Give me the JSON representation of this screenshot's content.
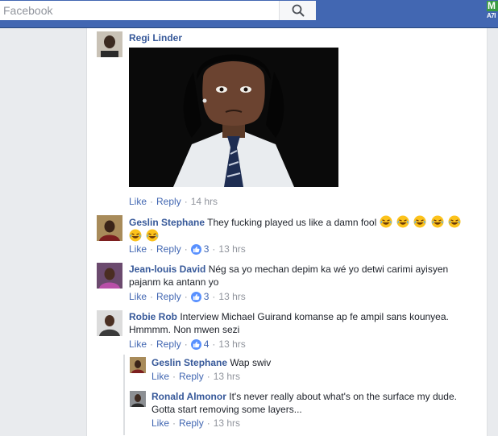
{
  "search": {
    "placeholder": "Facebook"
  },
  "brand": {
    "line1": "M",
    "line2": "A7I"
  },
  "comments": [
    {
      "author": "Regi Linder",
      "text": "",
      "has_photo": true,
      "like_label": "Like",
      "reply_label": "Reply",
      "time": "14 hrs"
    },
    {
      "author": "Geslin Stephane",
      "text": "They fucking played us like a damn fool",
      "emoji": "face-with-tears-of-joy",
      "emoji_count": 7,
      "like_label": "Like",
      "reply_label": "Reply",
      "reactions": "3",
      "time": "13 hrs"
    },
    {
      "author": "Jean-louis David",
      "text": "Nég sa yo mechan depim ka wé yo detwi carimi ayisyen pajanm ka antann yo",
      "like_label": "Like",
      "reply_label": "Reply",
      "reactions": "3",
      "time": "13 hrs"
    },
    {
      "author": "Robie Rob",
      "text": "Interview Michael Guirand komanse ap fe ampil sans kounyea. Hmmmm. Non mwen sezi",
      "like_label": "Like",
      "reply_label": "Reply",
      "reactions": "4",
      "time": "13 hrs"
    }
  ],
  "replies": [
    {
      "author": "Geslin Stephane",
      "text": "Wap swiv",
      "like_label": "Like",
      "reply_label": "Reply",
      "time": "13 hrs"
    },
    {
      "author": "Ronald Almonor",
      "text": "It's never really about what's on the surface my dude. Gotta start removing some layers...",
      "like_label": "Like",
      "reply_label": "Reply",
      "time": "13 hrs"
    }
  ],
  "colors": {
    "topbar": "#4267b2",
    "link": "#365899",
    "meta": "#90949c",
    "like_badge": "#5890ff"
  }
}
